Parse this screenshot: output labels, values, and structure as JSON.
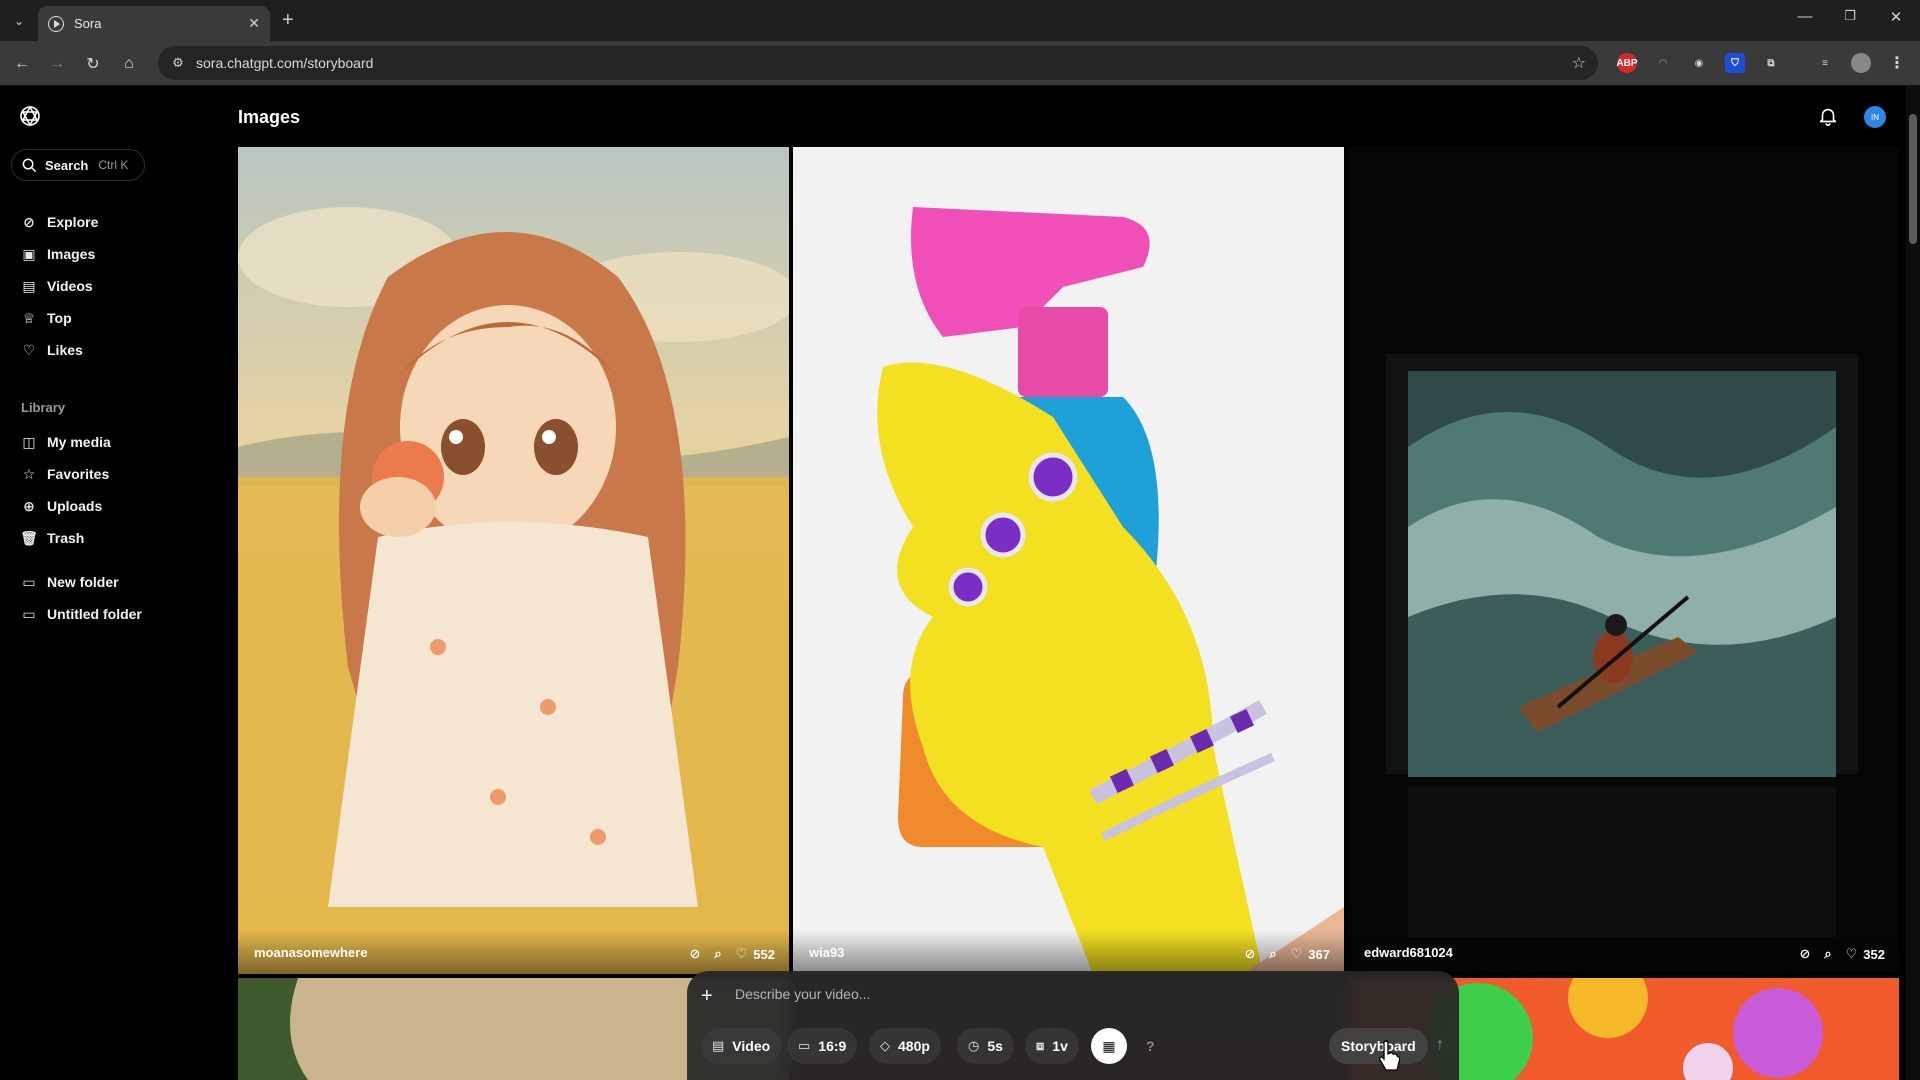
{
  "browser": {
    "tab_title": "Sora",
    "url": "sora.chatgpt.com/storyboard"
  },
  "app": {
    "search_label": "Search",
    "search_shortcut": "Ctrl K",
    "nav": [
      {
        "label": "Explore",
        "icon": "compass-icon"
      },
      {
        "label": "Images",
        "icon": "image-icon"
      },
      {
        "label": "Videos",
        "icon": "video-icon"
      },
      {
        "label": "Top",
        "icon": "trophy-icon"
      },
      {
        "label": "Likes",
        "icon": "heart-icon"
      }
    ],
    "library_label": "Library",
    "library": [
      {
        "label": "My media",
        "icon": "media-icon"
      },
      {
        "label": "Favorites",
        "icon": "star-icon"
      },
      {
        "label": "Uploads",
        "icon": "upload-icon"
      },
      {
        "label": "Trash",
        "icon": "trash-icon"
      }
    ],
    "folders": [
      {
        "label": "New folder",
        "icon": "folder-icon"
      },
      {
        "label": "Untitled folder",
        "icon": "folder-icon"
      }
    ],
    "page_title": "Images",
    "avatar_initials": "IN"
  },
  "cards": [
    {
      "user": "moanasomewhere",
      "likes": "552"
    },
    {
      "user": "wia93",
      "likes": "367"
    },
    {
      "user": "edward681024",
      "likes": "352"
    }
  ],
  "composer": {
    "placeholder": "Describe your video...",
    "type_label": "Video",
    "aspect_label": "16:9",
    "resolution_label": "480p",
    "duration_label": "5s",
    "variations_label": "1v",
    "help_label": "?",
    "storyboard_label": "Storyboard"
  }
}
